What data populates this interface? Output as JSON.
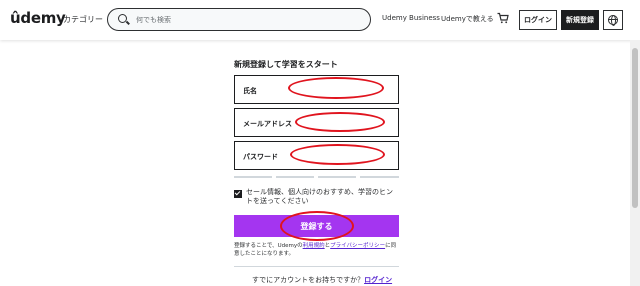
{
  "header": {
    "logo": "ûdemy",
    "category": "カテゴリー",
    "search_placeholder": "何でも検索",
    "business": "Udemy Business",
    "teach": "Udemyで教える",
    "login": "ログイン",
    "signup": "新規登録",
    "icons": [
      "search-icon",
      "cart-icon",
      "globe-icon"
    ]
  },
  "form": {
    "title": "新規登録して学習をスタート",
    "fields": [
      {
        "label": "氏名",
        "value": ""
      },
      {
        "label": "メールアドレス",
        "value": ""
      },
      {
        "label": "パスワード",
        "value": ""
      }
    ],
    "checkbox": {
      "checked": true,
      "label": "セール情報、個人向けのおすすめ、学習のヒントを送ってください"
    },
    "submit": "登録する",
    "terms": {
      "prefix": "登録することで、Udemyの",
      "terms_link": "利用規約",
      "middle": "と",
      "privacy_link": "プライバシーポリシー",
      "suffix": "に同意したことになります。"
    },
    "have_account": "すでにアカウントをお持ちですか？",
    "login_link": "ログイン"
  },
  "colors": {
    "accent": "#a435f0",
    "link": "#5624d0",
    "annotation": "#e0141e",
    "dark": "#1c1d1f"
  }
}
